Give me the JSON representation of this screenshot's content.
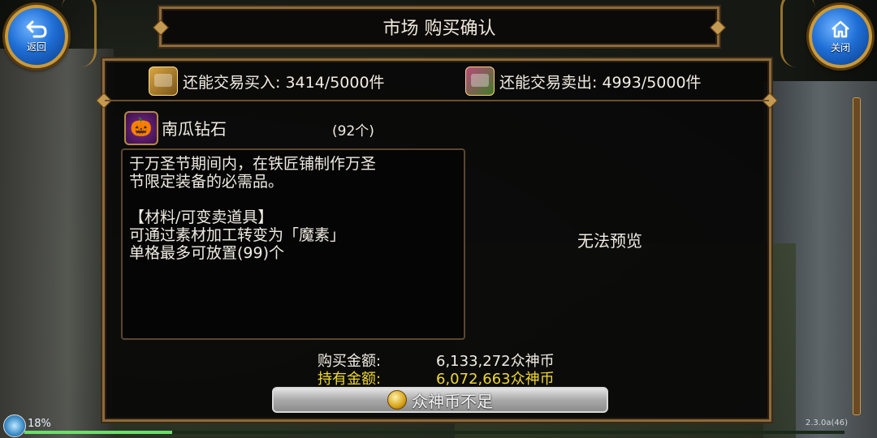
{
  "header": {
    "title": "市场 购买确认"
  },
  "nav": {
    "back_label": "返回",
    "close_label": "关闭"
  },
  "trade_limits": {
    "buy_label": "还能交易买入: 3414/5000件",
    "sell_label": "还能交易卖出: 4993/5000件"
  },
  "item": {
    "name": "南瓜钻石",
    "quantity": "(92个)",
    "description": [
      "于万圣节期间内，在铁匠铺制作万圣",
      "节限定装备的必需品。",
      "",
      "【材料/可变卖道具】",
      "可通过素材加工转变为「魔素」",
      "单格最多可放置(99)个"
    ],
    "preview_text": "无法预览"
  },
  "price": {
    "buy_label": "购买金额:",
    "buy_value": "6,133,272众神币",
    "hold_label": "持有金额:",
    "hold_value": "6,072,663众神币"
  },
  "confirm_button": {
    "label": "众神币不足"
  },
  "status": {
    "progress_text": "18%",
    "progress_fraction": 0.18,
    "version": "2.3.0a(46)"
  },
  "colors": {
    "frame_gold": "#8c6a3a",
    "hold_yellow": "#f0d832",
    "button_blue": "#1f6fd6"
  },
  "icons": {
    "back": "back-arrow-icon",
    "close": "home-icon",
    "buy": "treasure-chest-icon",
    "sell": "merchant-stall-icon",
    "item": "pumpkin-icon",
    "coin": "coin-icon"
  }
}
